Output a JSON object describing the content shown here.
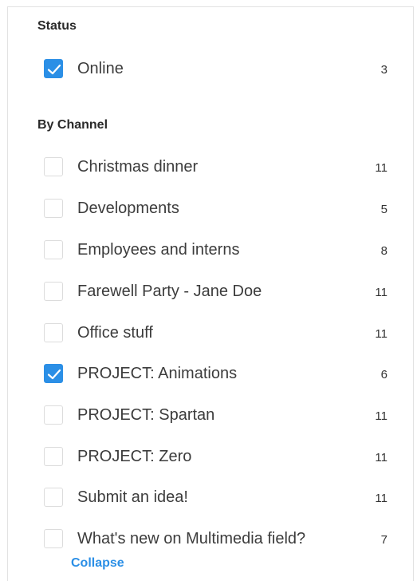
{
  "status": {
    "title": "Status",
    "items": [
      {
        "label": "Online",
        "count": "3",
        "checked": true
      }
    ]
  },
  "channels": {
    "title": "By Channel",
    "items": [
      {
        "label": "Christmas dinner",
        "count": "11",
        "checked": false
      },
      {
        "label": "Developments",
        "count": "5",
        "checked": false
      },
      {
        "label": "Employees and interns",
        "count": "8",
        "checked": false
      },
      {
        "label": "Farewell Party - Jane Doe",
        "count": "11",
        "checked": false
      },
      {
        "label": "Office stuff",
        "count": "11",
        "checked": false
      },
      {
        "label": "PROJECT: Animations",
        "count": "6",
        "checked": true
      },
      {
        "label": "PROJECT: Spartan",
        "count": "11",
        "checked": false
      },
      {
        "label": "PROJECT: Zero",
        "count": "11",
        "checked": false
      },
      {
        "label": "Submit an idea!",
        "count": "11",
        "checked": false
      },
      {
        "label": "What's new on Multimedia field?",
        "count": "7",
        "checked": false
      }
    ],
    "collapse_label": "Collapse"
  },
  "colors": {
    "accent": "#2b8fe6",
    "text": "#3c3c3c",
    "checkbox_border": "#dcdcdc"
  },
  "icons": {
    "checked": "check-icon"
  }
}
